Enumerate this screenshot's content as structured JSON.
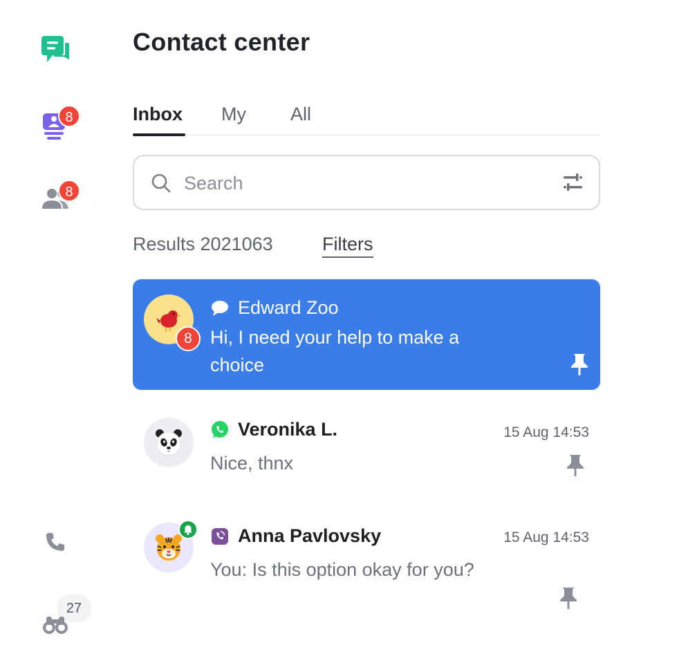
{
  "app": {
    "title": "Contact center"
  },
  "rail": {
    "items": [
      {
        "name": "chat-icon",
        "badge": ""
      },
      {
        "name": "queue-icon",
        "badge": "8"
      },
      {
        "name": "contacts-icon",
        "badge": "8"
      },
      {
        "name": "phone-icon",
        "badge": ""
      },
      {
        "name": "binoculars-icon",
        "count": "27"
      }
    ]
  },
  "tabs": [
    {
      "label": "Inbox",
      "active": true
    },
    {
      "label": "My",
      "active": false
    },
    {
      "label": "All",
      "active": false
    }
  ],
  "search": {
    "placeholder": "Search",
    "value": ""
  },
  "results": {
    "label": "Results 2021063",
    "filters_label": "Filters"
  },
  "conversations": [
    {
      "name": "Edward Zoo",
      "channel": "chat-bubble-icon",
      "message": "Hi, I need your help to make a choice",
      "time": "",
      "unread": "8",
      "avatar": "bird-icon",
      "selected": true,
      "pinned": true
    },
    {
      "name": "Veronika L.",
      "channel": "whatsapp-icon",
      "message": "Nice, thnx",
      "time": "15 Aug 14:53",
      "unread": "",
      "avatar": "panda-icon",
      "selected": false,
      "pinned": false
    },
    {
      "name": "Anna Pavlovsky",
      "channel": "viber-icon",
      "message": "You: Is this option okay for you?",
      "time": "15 Aug 14:53",
      "unread": "",
      "avatar": "tiger-icon",
      "notification": "bell-icon",
      "selected": false,
      "pinned": false
    }
  ],
  "colors": {
    "accent": "#3a7de8",
    "brand_green": "#1fbf8f",
    "badge_red": "#f04438",
    "queue_purple": "#7b61e8"
  }
}
